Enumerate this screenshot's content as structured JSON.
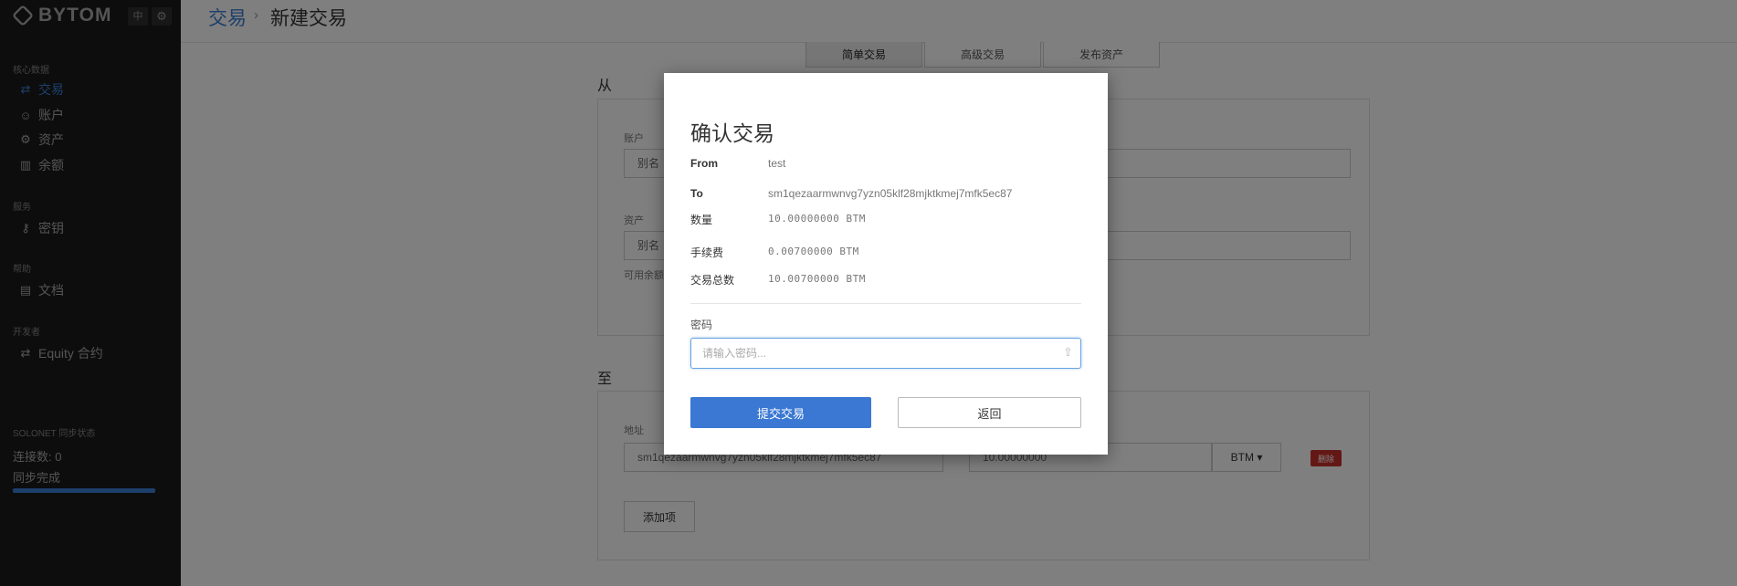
{
  "sidebar": {
    "brand": "BYTOM",
    "lang_toggle": "中",
    "sections": [
      {
        "title": "核心数据",
        "items": [
          {
            "label": "交易",
            "icon": "exchange-icon",
            "active": true
          },
          {
            "label": "账户",
            "icon": "user-icon"
          },
          {
            "label": "资产",
            "icon": "asset-icon"
          },
          {
            "label": "余额",
            "icon": "chart-icon"
          }
        ]
      },
      {
        "title": "服务",
        "items": [
          {
            "label": "密钥",
            "icon": "key-icon"
          }
        ]
      },
      {
        "title": "帮助",
        "items": [
          {
            "label": "文档",
            "icon": "document-icon"
          }
        ]
      },
      {
        "title": "开发者",
        "items": [
          {
            "label": "Equity 合约",
            "icon": "exchange-icon"
          }
        ]
      }
    ],
    "sync": {
      "title": "SOLONET 同步状态",
      "connections": "连接数: 0",
      "status": "同步完成",
      "progress": 1.0
    }
  },
  "header": {
    "breadcrumb_parent": "交易",
    "breadcrumb_current": "新建交易"
  },
  "tabs": [
    {
      "label": "简单交易",
      "active": true
    },
    {
      "label": "高级交易"
    },
    {
      "label": "发布资产"
    }
  ],
  "form": {
    "from_heading": "从",
    "account_label": "账户",
    "account_value": "别名",
    "asset_label": "资产",
    "asset_value": "别名",
    "available_label": "可用余额",
    "to_heading": "至",
    "address_label": "地址",
    "address_value": "sm1qezaarmwnvg7yzn05klf28mjktkmej7mfk5ec87",
    "amount_value": "10.00000000",
    "unit_button": "BTM ▾",
    "delete_button": "删除",
    "add_button": "添加项"
  },
  "modal": {
    "title": "确认交易",
    "from_label": "From",
    "from_value": "test",
    "to_label": "To",
    "to_value": "sm1qezaarmwnvg7yzn05klf28mjktkmej7mfk5ec87",
    "amount_label": "数量",
    "amount_value": "10.00000000 BTM",
    "fee_label": "手续费",
    "fee_value": "0.00700000 BTM",
    "total_label": "交易总数",
    "total_value": "10.00700000 BTM",
    "password_label": "密码",
    "password_placeholder": "请输入密码...",
    "submit_label": "提交交易",
    "back_label": "返回"
  }
}
